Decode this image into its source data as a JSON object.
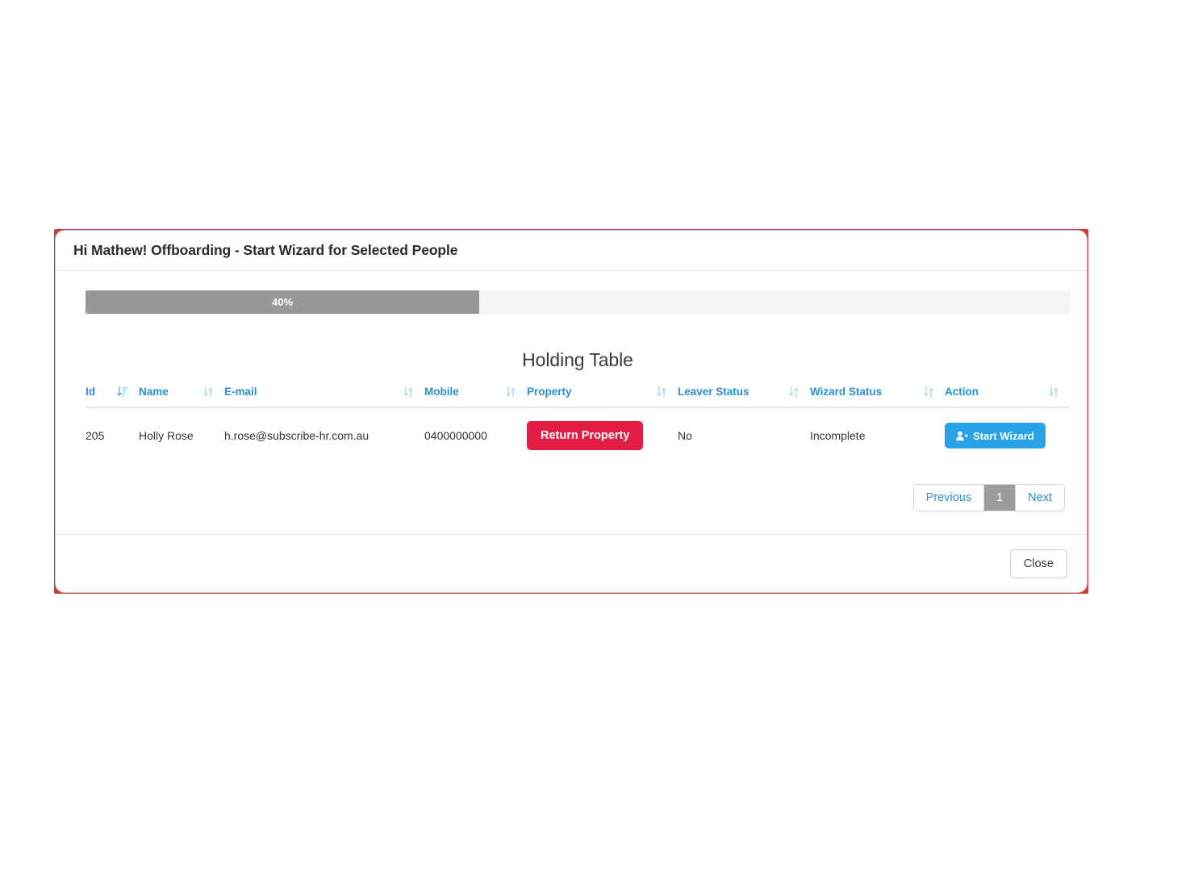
{
  "modal": {
    "title": "Hi Mathew! Offboarding - Start Wizard for Selected People"
  },
  "progress": {
    "label": "40%",
    "percent": 40,
    "fill_color": "#989898",
    "track_color": "#f4f4f4"
  },
  "section": {
    "title": "Holding Table"
  },
  "table": {
    "columns": [
      {
        "label": "Id",
        "sort_icon": "sort-amount-desc-icon",
        "sort_state": "desc"
      },
      {
        "label": "Name",
        "sort_icon": "sort-icon",
        "sort_state": "none"
      },
      {
        "label": "E-mail",
        "sort_icon": "sort-icon",
        "sort_state": "none"
      },
      {
        "label": "Mobile",
        "sort_icon": "sort-icon",
        "sort_state": "none"
      },
      {
        "label": "Property",
        "sort_icon": "sort-icon",
        "sort_state": "none"
      },
      {
        "label": "Leaver Status",
        "sort_icon": "sort-icon",
        "sort_state": "none"
      },
      {
        "label": "Wizard Status",
        "sort_icon": "sort-icon",
        "sort_state": "none"
      },
      {
        "label": "Action",
        "sort_icon": "sort-icon",
        "sort_state": "none"
      }
    ],
    "rows": [
      {
        "id": "205",
        "name": "Holly Rose",
        "email": "h.rose@subscribe-hr.com.au",
        "mobile": "0400000000",
        "property_button": "Return Property",
        "leaver_status": "No",
        "wizard_status": "Incomplete",
        "action_button": "Start Wizard",
        "action_icon": "user-plus-icon"
      }
    ]
  },
  "pagination": {
    "previous": "Previous",
    "pages": [
      "1"
    ],
    "current_page": "1",
    "next": "Next"
  },
  "footer": {
    "close_label": "Close"
  },
  "colors": {
    "header_link": "#2b8fd6",
    "danger": "#e31c44",
    "info": "#29a3e8",
    "incomplete_text": "#f4554f",
    "outline_red": "#cf3b3b"
  }
}
